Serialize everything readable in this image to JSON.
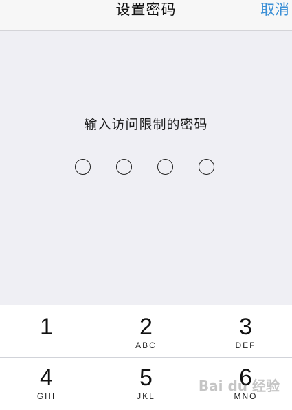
{
  "navbar": {
    "title": "设置密码",
    "cancel_label": "取消"
  },
  "prompt": "输入访问限制的密码",
  "passcode": {
    "length": 4,
    "entered": 0
  },
  "keypad": {
    "keys": [
      {
        "num": "1",
        "letters": ""
      },
      {
        "num": "2",
        "letters": "ABC"
      },
      {
        "num": "3",
        "letters": "DEF"
      },
      {
        "num": "4",
        "letters": "GHI"
      },
      {
        "num": "5",
        "letters": "JKL"
      },
      {
        "num": "6",
        "letters": "MNO"
      }
    ]
  },
  "watermark": "Bai du 经验",
  "colors": {
    "background": "#efeff4",
    "accent": "#3a8fd6",
    "keypad_bg": "#d1d3d9",
    "key_bg": "#ffffff"
  }
}
